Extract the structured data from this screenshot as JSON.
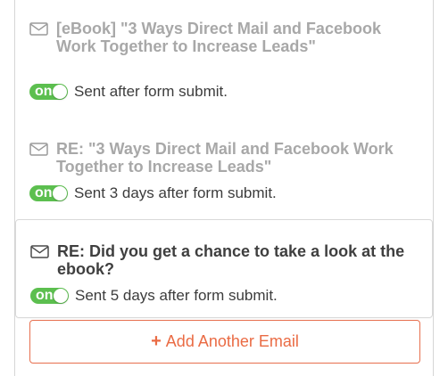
{
  "emails": [
    {
      "subject": "[eBook] \"3 Ways Direct Mail and Facebook Work Together to Increase Leads\"",
      "toggle_label": "on",
      "status": "Sent after form submit.",
      "selected": false
    },
    {
      "subject": "RE: \"3 Ways Direct Mail and Facebook Work Together to Increase Leads\"",
      "toggle_label": "on",
      "status": "Sent 3 days after form submit.",
      "selected": false
    },
    {
      "subject": "RE: Did you get a chance to take a look at the ebook?",
      "toggle_label": "on",
      "status": "Sent 5 days after form submit.",
      "selected": true
    }
  ],
  "actions": {
    "add_email_label": "Add Another Email",
    "add_icon": "+"
  },
  "icons": {
    "email": "mail-envelope-icon",
    "add": "plus-icon"
  },
  "colors": {
    "toggle_on": "#5cbf4f",
    "accent": "#ea6b44",
    "muted_text": "#a8a8a8",
    "dark_text": "#3f3f3f",
    "border": "#d6d6d6"
  }
}
